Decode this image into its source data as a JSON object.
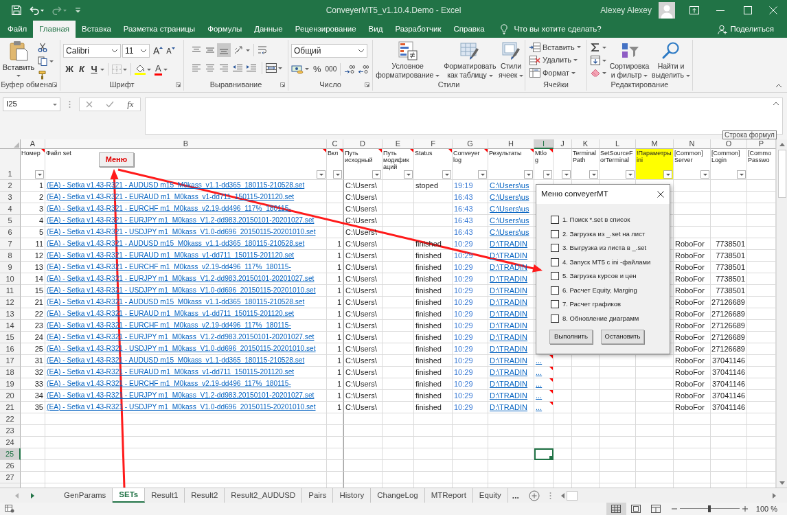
{
  "title_bar": {
    "title": "ConveyerMT5_v1.10.4.Demo - Excel",
    "user": "Alexey Alexey"
  },
  "ribbon_tabs": [
    {
      "label": "Файл",
      "selected": false
    },
    {
      "label": "Главная",
      "selected": true
    },
    {
      "label": "Вставка",
      "selected": false
    },
    {
      "label": "Разметка страницы",
      "selected": false
    },
    {
      "label": "Формулы",
      "selected": false
    },
    {
      "label": "Данные",
      "selected": false
    },
    {
      "label": "Рецензирование",
      "selected": false
    },
    {
      "label": "Вид",
      "selected": false
    },
    {
      "label": "Разработчик",
      "selected": false
    },
    {
      "label": "Справка",
      "selected": false
    }
  ],
  "tell_me": "Что вы хотите сделать?",
  "share": "Поделиться",
  "ribbon": {
    "clipboard": {
      "paste": "Вставить",
      "label": "Буфер обмена"
    },
    "font": {
      "name": "Calibri",
      "size": "11",
      "grow": "A",
      "shrink": "A",
      "bold": "Ж",
      "italic": "К",
      "underline": "Ч",
      "font_color": "A",
      "label": "Шрифт"
    },
    "alignment": {
      "vertical": [
        {
          "kind": "top",
          "selected": false
        },
        {
          "kind": "middle",
          "selected": false
        },
        {
          "kind": "bottom",
          "selected": true
        }
      ],
      "label": "Выравнивание"
    },
    "number": {
      "format": "Общий",
      "percent": "%",
      "thousands": "000",
      "label": "Число"
    },
    "styles": {
      "buttons": [
        {
          "kind": "conditional",
          "label": "Условное форматирование"
        },
        {
          "kind": "table",
          "label": "Форматировать как таблицу"
        },
        {
          "kind": "cell_styles",
          "label": "Стили ячеек"
        }
      ],
      "label": "Стили"
    },
    "cells": {
      "buttons": [
        {
          "kind": "insert",
          "label": "Вставить"
        },
        {
          "kind": "delete",
          "label": "Удалить"
        },
        {
          "kind": "format",
          "label": "Формат"
        }
      ],
      "label": "Ячейки"
    },
    "editing": {
      "sort": "Сортировка и фильтр",
      "find": "Найти и выделить",
      "label": "Редактирование"
    }
  },
  "formula_bar": {
    "name_box": "I25",
    "function_button": "fx",
    "tooltip": "Строка формул"
  },
  "sheet": {
    "columns": [
      {
        "letter": "A",
        "selected": false
      },
      {
        "letter": "B",
        "selected": false
      },
      {
        "letter": "C",
        "selected": false
      },
      {
        "letter": "D",
        "selected": false
      },
      {
        "letter": "E",
        "selected": false
      },
      {
        "letter": "F",
        "selected": false
      },
      {
        "letter": "G",
        "selected": false
      },
      {
        "letter": "H",
        "selected": false
      },
      {
        "letter": "I",
        "selected": true
      },
      {
        "letter": "J",
        "selected": false
      },
      {
        "letter": "K",
        "selected": false
      },
      {
        "letter": "L",
        "selected": false
      },
      {
        "letter": "M",
        "selected": false
      },
      {
        "letter": "N",
        "selected": false
      },
      {
        "letter": "O",
        "selected": false
      },
      {
        "letter": "P",
        "selected": false
      }
    ],
    "header_row": {
      "number": "1",
      "cells": [
        {
          "text": "Номер",
          "comment": true,
          "filter": true
        },
        {
          "text": "Файл set",
          "comment": true,
          "filter": true
        },
        {
          "text": "Вкл",
          "comment": true,
          "filter": true
        },
        {
          "text": "Путь исходный",
          "comment": true,
          "filter": true
        },
        {
          "text": "Путь модификаций",
          "comment": true,
          "filter": true
        },
        {
          "text": "Status",
          "comment": true,
          "filter": true
        },
        {
          "text": "Conveyer log",
          "comment": true,
          "filter": true
        },
        {
          "text": "Результаты",
          "comment": true,
          "filter": true
        },
        {
          "text": "Mtlog",
          "comment": true,
          "filter": true
        },
        {
          "comment": false,
          "filter": true
        },
        {
          "text": "TerminalPath",
          "comment": false,
          "filter": true
        },
        {
          "text": "SetSourceForTerminal",
          "comment": false,
          "filter": true
        },
        {
          "text": "!Параметры ini",
          "comment": false,
          "filter": true,
          "color": "#ffff00"
        },
        {
          "text": "[Common] Server",
          "comment": false,
          "filter": true
        },
        {
          "text": "[Common] Login",
          "comment": false,
          "filter": true
        },
        {
          "text": "[Commo Passwo",
          "comment": false,
          "filter": false
        }
      ]
    },
    "menu_button": "Меню",
    "rows": [
      {
        "number": "2",
        "selected": false,
        "mt_log_comment": false,
        "cells": {
          "number": "1",
          "file": "(EA) - Setka v1.43-R321 - AUDUSD m15_M0kass_v1.1-dd365_180115-210528.set",
          "source_path": "C:\\Users\\",
          "status": "stoped",
          "conveyer_log": "19:19",
          "results": "C:\\Users\\us"
        }
      },
      {
        "number": "3",
        "selected": false,
        "mt_log_comment": false,
        "cells": {
          "number": "2",
          "file": "(EA) - Setka v1.43-R321 - EURAUD m1_M0kass_v1-dd711_150115-201120.set",
          "source_path": "C:\\Users\\",
          "conveyer_log": "16:43",
          "results": "C:\\Users\\us"
        }
      },
      {
        "number": "4",
        "selected": false,
        "mt_log_comment": false,
        "cells": {
          "number": "3",
          "file": "(EA) - Setka v1.43-R321 - EURCHF m1_M0kass_v2.19-dd496_117%_180115-",
          "source_path": "C:\\Users\\",
          "conveyer_log": "16:43",
          "results": "C:\\Users\\us"
        }
      },
      {
        "number": "5",
        "selected": false,
        "mt_log_comment": false,
        "cells": {
          "number": "4",
          "file": "(EA) - Setka v1.43-R321 - EURJPY m1_M0kass_V1.2-dd983.20150101-20201027.set",
          "source_path": "C:\\Users\\",
          "conveyer_log": "16:43",
          "results": "C:\\Users\\us"
        }
      },
      {
        "number": "6",
        "selected": false,
        "mt_log_comment": false,
        "cells": {
          "number": "5",
          "file": "(EA) - Setka v1.43-R321 - USDJPY m1_M0kass_V1.0-dd696_20150115-20201010.set",
          "source_path": "C:\\Users\\",
          "conveyer_log": "16:43",
          "results": "C:\\Users\\us"
        }
      },
      {
        "number": "7",
        "selected": false,
        "mt_log_comment": false,
        "cells": {
          "number": "11",
          "file": "(EA) - Setka v1.43-R321 - AUDUSD m15_M0kass_v1.1-dd365_180115-210528.set",
          "enabled": "1",
          "source_path": "C:\\Users\\",
          "status": "finished",
          "conveyer_log": "10:29",
          "results": "D:\\TRADIN",
          "server": "RoboFor",
          "login": "7738501"
        }
      },
      {
        "number": "8",
        "selected": false,
        "mt_log_comment": false,
        "cells": {
          "number": "12",
          "file": "(EA) - Setka v1.43-R321 - EURAUD m1_M0kass_v1-dd711_150115-201120.set",
          "enabled": "1",
          "source_path": "C:\\Users\\",
          "status": "finished",
          "conveyer_log": "10:29",
          "results": "D:\\TRADIN",
          "server": "RoboFor",
          "login": "7738501"
        }
      },
      {
        "number": "9",
        "selected": false,
        "mt_log_comment": false,
        "cells": {
          "number": "13",
          "file": "(EA) - Setka v1.43-R321 - EURCHF m1_M0kass_v2.19-dd496_117%_180115-",
          "enabled": "1",
          "source_path": "C:\\Users\\",
          "status": "finished",
          "conveyer_log": "10:29",
          "results": "D:\\TRADIN",
          "server": "RoboFor",
          "login": "7738501"
        }
      },
      {
        "number": "10",
        "selected": false,
        "mt_log_comment": false,
        "cells": {
          "number": "14",
          "file": "(EA) - Setka v1.43-R321 - EURJPY m1_M0kass_V1.2-dd983.20150101-20201027.set",
          "enabled": "1",
          "source_path": "C:\\Users\\",
          "status": "finished",
          "conveyer_log": "10:29",
          "results": "D:\\TRADIN",
          "server": "RoboFor",
          "login": "7738501"
        }
      },
      {
        "number": "11",
        "selected": false,
        "mt_log_comment": false,
        "cells": {
          "number": "15",
          "file": "(EA) - Setka v1.43-R321 - USDJPY m1_M0kass_V1.0-dd696_20150115-20201010.set",
          "enabled": "1",
          "source_path": "C:\\Users\\",
          "status": "finished",
          "conveyer_log": "10:29",
          "results": "D:\\TRADIN",
          "server": "RoboFor",
          "login": "7738501"
        }
      },
      {
        "number": "12",
        "selected": false,
        "mt_log_comment": false,
        "cells": {
          "number": "21",
          "file": "(EA) - Setka v1.43-R321 - AUDUSD m15_M0kass_v1.1-dd365_180115-210528.set",
          "enabled": "1",
          "source_path": "C:\\Users\\",
          "status": "finished",
          "conveyer_log": "10:29",
          "results": "D:\\TRADIN",
          "server": "RoboFor",
          "login": "27126689"
        }
      },
      {
        "number": "13",
        "selected": false,
        "mt_log_comment": false,
        "cells": {
          "number": "22",
          "file": "(EA) - Setka v1.43-R321 - EURAUD m1_M0kass_v1-dd711_150115-201120.set",
          "enabled": "1",
          "source_path": "C:\\Users\\",
          "status": "finished",
          "conveyer_log": "10:29",
          "results": "D:\\TRADIN",
          "server": "RoboFor",
          "login": "27126689"
        }
      },
      {
        "number": "14",
        "selected": false,
        "mt_log_comment": false,
        "cells": {
          "number": "23",
          "file": "(EA) - Setka v1.43-R321 - EURCHF m1_M0kass_v2.19-dd496_117%_180115-",
          "enabled": "1",
          "source_path": "C:\\Users\\",
          "status": "finished",
          "conveyer_log": "10:29",
          "results": "D:\\TRADIN",
          "server": "RoboFor",
          "login": "27126689"
        }
      },
      {
        "number": "15",
        "selected": false,
        "mt_log_comment": false,
        "cells": {
          "number": "24",
          "file": "(EA) - Setka v1.43-R321 - EURJPY m1_M0kass_V1.2-dd983.20150101-20201027.set",
          "enabled": "1",
          "source_path": "C:\\Users\\",
          "status": "finished",
          "conveyer_log": "10:29",
          "results": "D:\\TRADIN",
          "server": "RoboFor",
          "login": "27126689"
        }
      },
      {
        "number": "16",
        "selected": false,
        "mt_log_comment": false,
        "cells": {
          "number": "25",
          "file": "(EA) - Setka v1.43-R321 - USDJPY m1_M0kass_V1.0-dd696_20150115-20201010.set",
          "enabled": "1",
          "source_path": "C:\\Users\\",
          "status": "finished",
          "conveyer_log": "10:29",
          "results": "D:\\TRADIN",
          "server": "RoboFor",
          "login": "27126689"
        }
      },
      {
        "number": "17",
        "selected": false,
        "mt_log_comment": true,
        "cells": {
          "number": "31",
          "file": "(EA) - Setka v1.43-R321 - AUDUSD m15_M0kass_v1.1-dd365_180115-210528.set",
          "enabled": "1",
          "source_path": "C:\\Users\\",
          "status": "finished",
          "conveyer_log": "10:29",
          "results": "D:\\TRADIN",
          "mt_log": "...",
          "server": "RoboFor",
          "login": "37041146"
        }
      },
      {
        "number": "18",
        "selected": false,
        "mt_log_comment": true,
        "cells": {
          "number": "32",
          "file": "(EA) - Setka v1.43-R321 - EURAUD m1_M0kass_v1-dd711_150115-201120.set",
          "enabled": "1",
          "source_path": "C:\\Users\\",
          "status": "finished",
          "conveyer_log": "10:29",
          "results": "D:\\TRADIN",
          "mt_log": "...",
          "server": "RoboFor",
          "login": "37041146"
        }
      },
      {
        "number": "19",
        "selected": false,
        "mt_log_comment": true,
        "cells": {
          "number": "33",
          "file": "(EA) - Setka v1.43-R321 - EURCHF m1_M0kass_v2.19-dd496_117%_180115-",
          "enabled": "1",
          "source_path": "C:\\Users\\",
          "status": "finished",
          "conveyer_log": "10:29",
          "results": "D:\\TRADIN",
          "mt_log": "...",
          "server": "RoboFor",
          "login": "37041146"
        }
      },
      {
        "number": "20",
        "selected": false,
        "mt_log_comment": true,
        "cells": {
          "number": "34",
          "file": "(EA) - Setka v1.43-R321 - EURJPY m1_M0kass_V1.2-dd983.20150101-20201027.set",
          "enabled": "1",
          "source_path": "C:\\Users\\",
          "status": "finished",
          "conveyer_log": "10:29",
          "results": "D:\\TRADIN",
          "mt_log": "...",
          "server": "RoboFor",
          "login": "37041146"
        }
      },
      {
        "number": "21",
        "selected": false,
        "mt_log_comment": true,
        "cells": {
          "number": "35",
          "file": "(EA) - Setka v1.43-R321 - USDJPY m1_M0kass_V1.0-dd696_20150115-20201010.set",
          "enabled": "1",
          "source_path": "C:\\Users\\",
          "status": "finished",
          "conveyer_log": "10:29",
          "results": "D:\\TRADIN",
          "mt_log": "...",
          "server": "RoboFor",
          "login": "37041146"
        }
      },
      {
        "number": "22",
        "selected": false,
        "mt_log_comment": false
      },
      {
        "number": "23",
        "selected": false,
        "mt_log_comment": false
      },
      {
        "number": "24",
        "selected": false,
        "mt_log_comment": false
      },
      {
        "number": "25",
        "selected": true,
        "mt_log_comment": false
      },
      {
        "number": "26",
        "selected": false,
        "mt_log_comment": false
      },
      {
        "number": "27",
        "selected": false,
        "mt_log_comment": false
      }
    ]
  },
  "dialog": {
    "title": "Меню conveyerMT",
    "options": [
      {
        "label": "1. Поиск *.set в список",
        "checked": false
      },
      {
        "label": "2. Загрузка из _.set на лист",
        "checked": false
      },
      {
        "label": "3. Выгрузка из листа в _.set",
        "checked": false
      },
      {
        "label": "4. Запуск MT5 с ini -файлами",
        "checked": false
      },
      {
        "label": "5. Загрузка курсов и цен",
        "checked": false
      },
      {
        "label": "6. Расчет Equity, Marging",
        "checked": false
      },
      {
        "label": "7. Расчет графиков",
        "checked": false
      },
      {
        "label": "8. Обновление диаграмм",
        "checked": false
      }
    ],
    "buttons": [
      "Выполнить",
      "Остановить"
    ]
  },
  "sheet_tab_bar": {
    "tabs": [
      {
        "label": "GenParams",
        "selected": false
      },
      {
        "label": "SETs",
        "selected": true
      },
      {
        "label": "Result1",
        "selected": false
      },
      {
        "label": "Result2",
        "selected": false
      },
      {
        "label": "Result2_AUDUSD",
        "selected": false
      },
      {
        "label": "Pairs",
        "selected": false
      },
      {
        "label": "History",
        "selected": false
      },
      {
        "label": "ChangeLog",
        "selected": false
      },
      {
        "label": "MTReport",
        "selected": false
      },
      {
        "label": "Equity",
        "selected": false
      }
    ],
    "more": "..."
  },
  "status_bar": {
    "views": [
      {
        "kind": "normal",
        "selected": true
      },
      {
        "kind": "page_layout",
        "selected": false
      },
      {
        "kind": "page_break",
        "selected": false
      }
    ],
    "zoom": {
      "level": 0.5,
      "label": "100 %"
    }
  }
}
